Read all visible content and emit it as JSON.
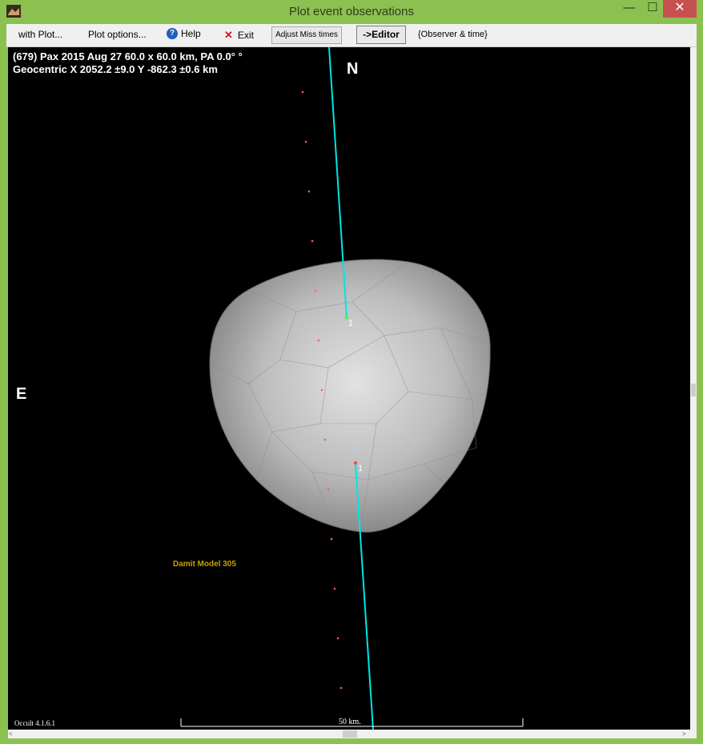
{
  "window": {
    "title": "Plot event observations",
    "minimize_glyph": "—",
    "maximize_glyph": "☐",
    "close_glyph": "✕"
  },
  "menu": {
    "with_plot": "with Plot...",
    "plot_options": "Plot options...",
    "help": "Help",
    "exit": "Exit",
    "adjust_miss_times": "Adjust Miss times",
    "editor": "->Editor",
    "observer_time": "{Observer & time}"
  },
  "plot": {
    "header_line1": "(679) Pax  2015 Aug 27  60.0 x 60.0 km, PA 0.0° °",
    "header_line2": "Geocentric  X  2052.2 ±9.0  Y -862.3 ±0.6 km",
    "north_label": "N",
    "east_label": "E",
    "model_label": "Damit Model 305",
    "version_label": "Occult 4.1.6.1",
    "scale_label": "50 km.",
    "chord_label_1": "1",
    "chord_label_2": "1"
  },
  "colors": {
    "plot_background": "#000000",
    "chord_line": "#00e5e5",
    "miss_dot": "#ff5a6a",
    "model_label": "#c8a000",
    "window_frame": "#8cc152"
  },
  "icons": {
    "app": "app-icon",
    "help": "help-icon",
    "exit": "close-icon"
  }
}
